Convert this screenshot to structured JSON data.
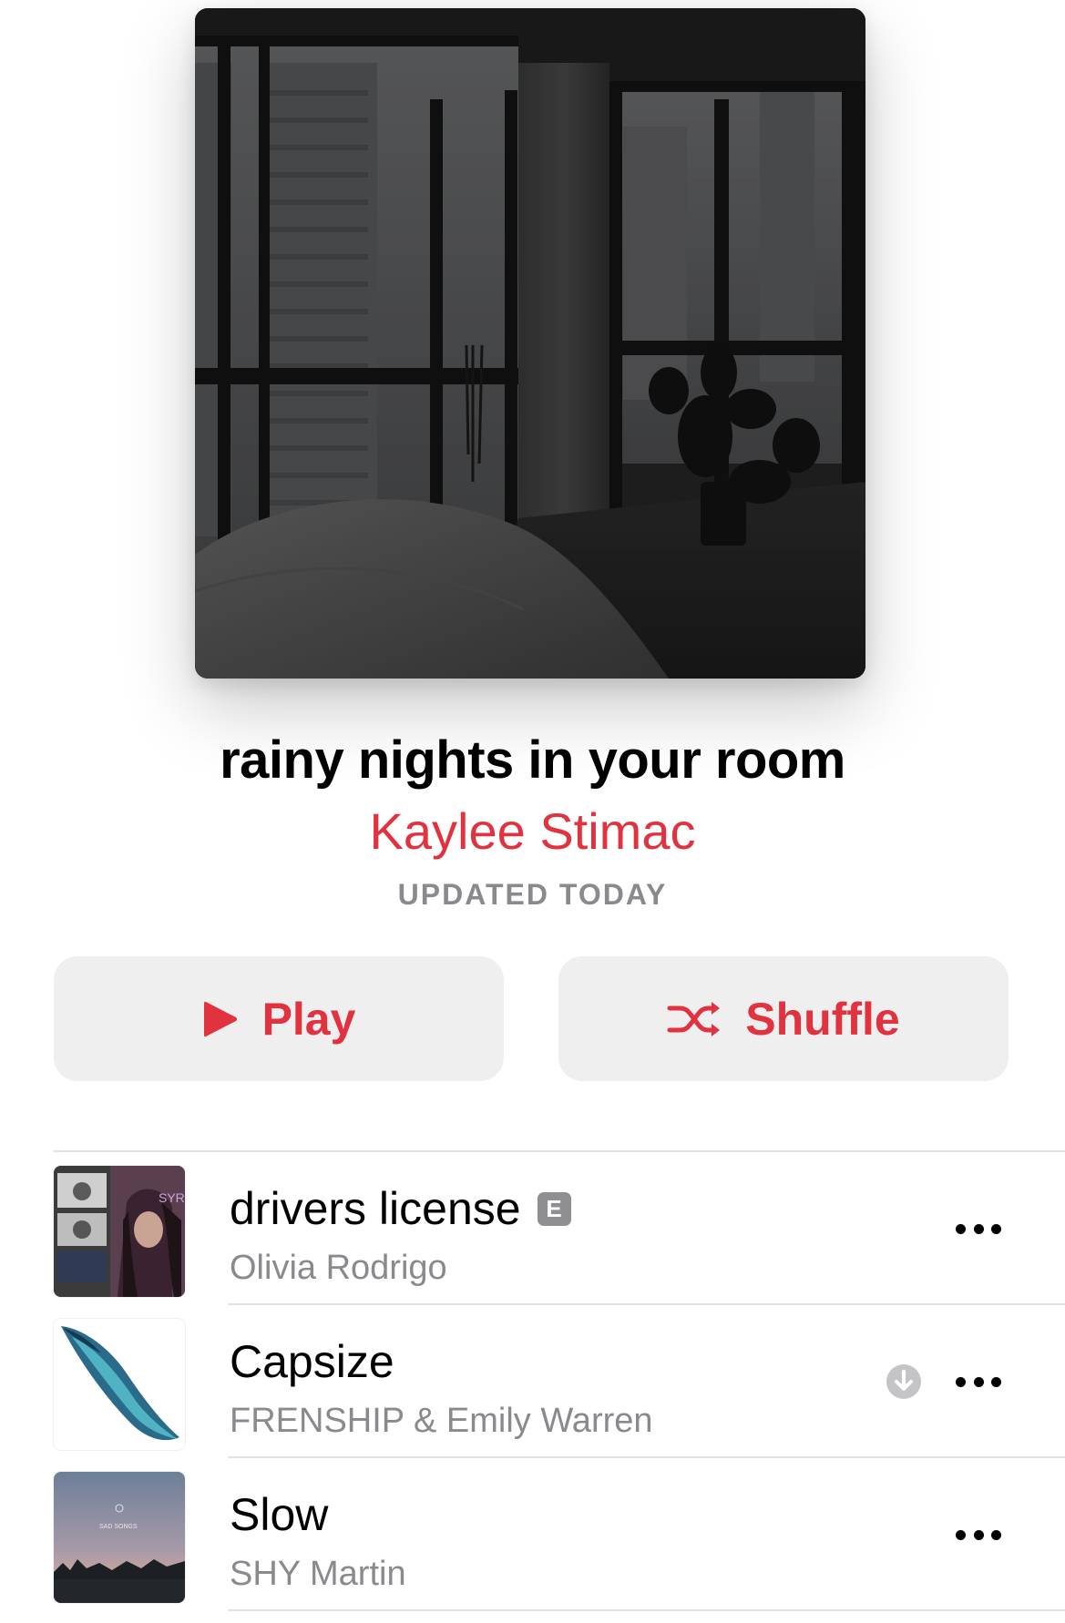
{
  "playlist": {
    "title": "rainy nights in your room",
    "curator": "Kaylee Stimac",
    "updated": "UPDATED TODAY"
  },
  "buttons": {
    "play_label": "Play",
    "shuffle_label": "Shuffle"
  },
  "colors": {
    "accent": "#e0323f",
    "secondary_text": "#8a8a8e",
    "button_bg": "#efeff0"
  },
  "tracks": [
    {
      "title": "drivers license",
      "artist": "Olivia Rodrigo",
      "explicit": true,
      "explicit_label": "E",
      "downloaded": false
    },
    {
      "title": "Capsize",
      "artist": "FRENSHIP & Emily Warren",
      "explicit": false,
      "downloaded": true
    },
    {
      "title": "Slow",
      "artist": "SHY Martin",
      "explicit": false,
      "downloaded": false
    }
  ]
}
